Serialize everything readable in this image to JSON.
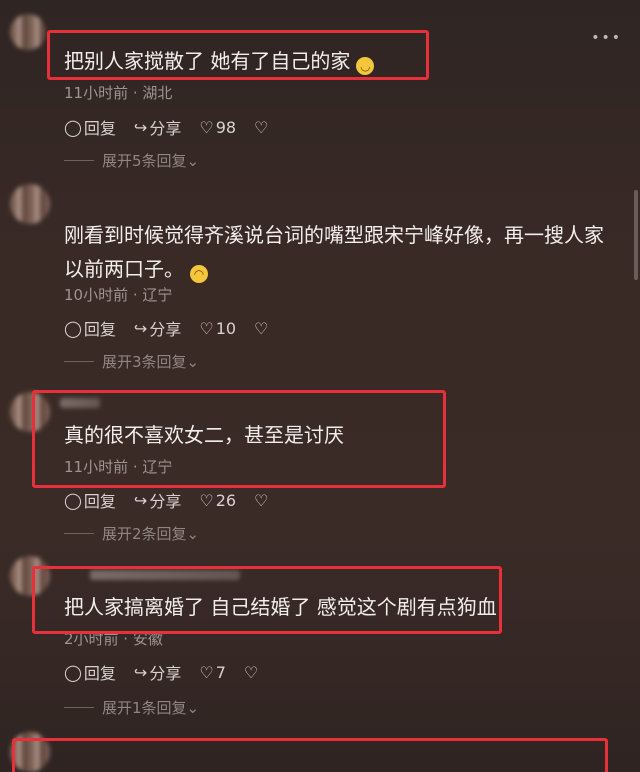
{
  "comments": [
    {
      "text": "把别人家搅散了  她有了自己的家",
      "emoji": "😌",
      "meta": "11小时前 · 湖北",
      "reply": "回复",
      "share": "分享",
      "likes": "98",
      "expand": "展开5条回复"
    },
    {
      "text": "刚看到时候觉得齐溪说台词的嘴型跟宋宁峰好像，再一搜人家以前两口子。",
      "emoji": "😂",
      "meta": "10小时前 · 辽宁",
      "reply": "回复",
      "share": "分享",
      "likes": "10",
      "expand": "展开3条回复"
    },
    {
      "text": "真的很不喜欢女二，甚至是讨厌",
      "meta": "11小时前 · 辽宁",
      "reply": "回复",
      "share": "分享",
      "likes": "26",
      "expand": "展开2条回复"
    },
    {
      "text": "把人家搞离婚了 自己结婚了 感觉这个剧有点狗血",
      "meta": "2小时前 · 安徽",
      "reply": "回复",
      "share": "分享",
      "likes": "7",
      "expand": "展开1条回复"
    }
  ],
  "icons": {
    "reply": "reply-bubble-icon",
    "share": "share-arrow-icon",
    "like": "heart-icon",
    "dislike": "broken-heart-icon",
    "expand": "chevron-down-icon"
  },
  "colors": {
    "highlight_box": "#e8303a",
    "background": "#3a2a26"
  }
}
